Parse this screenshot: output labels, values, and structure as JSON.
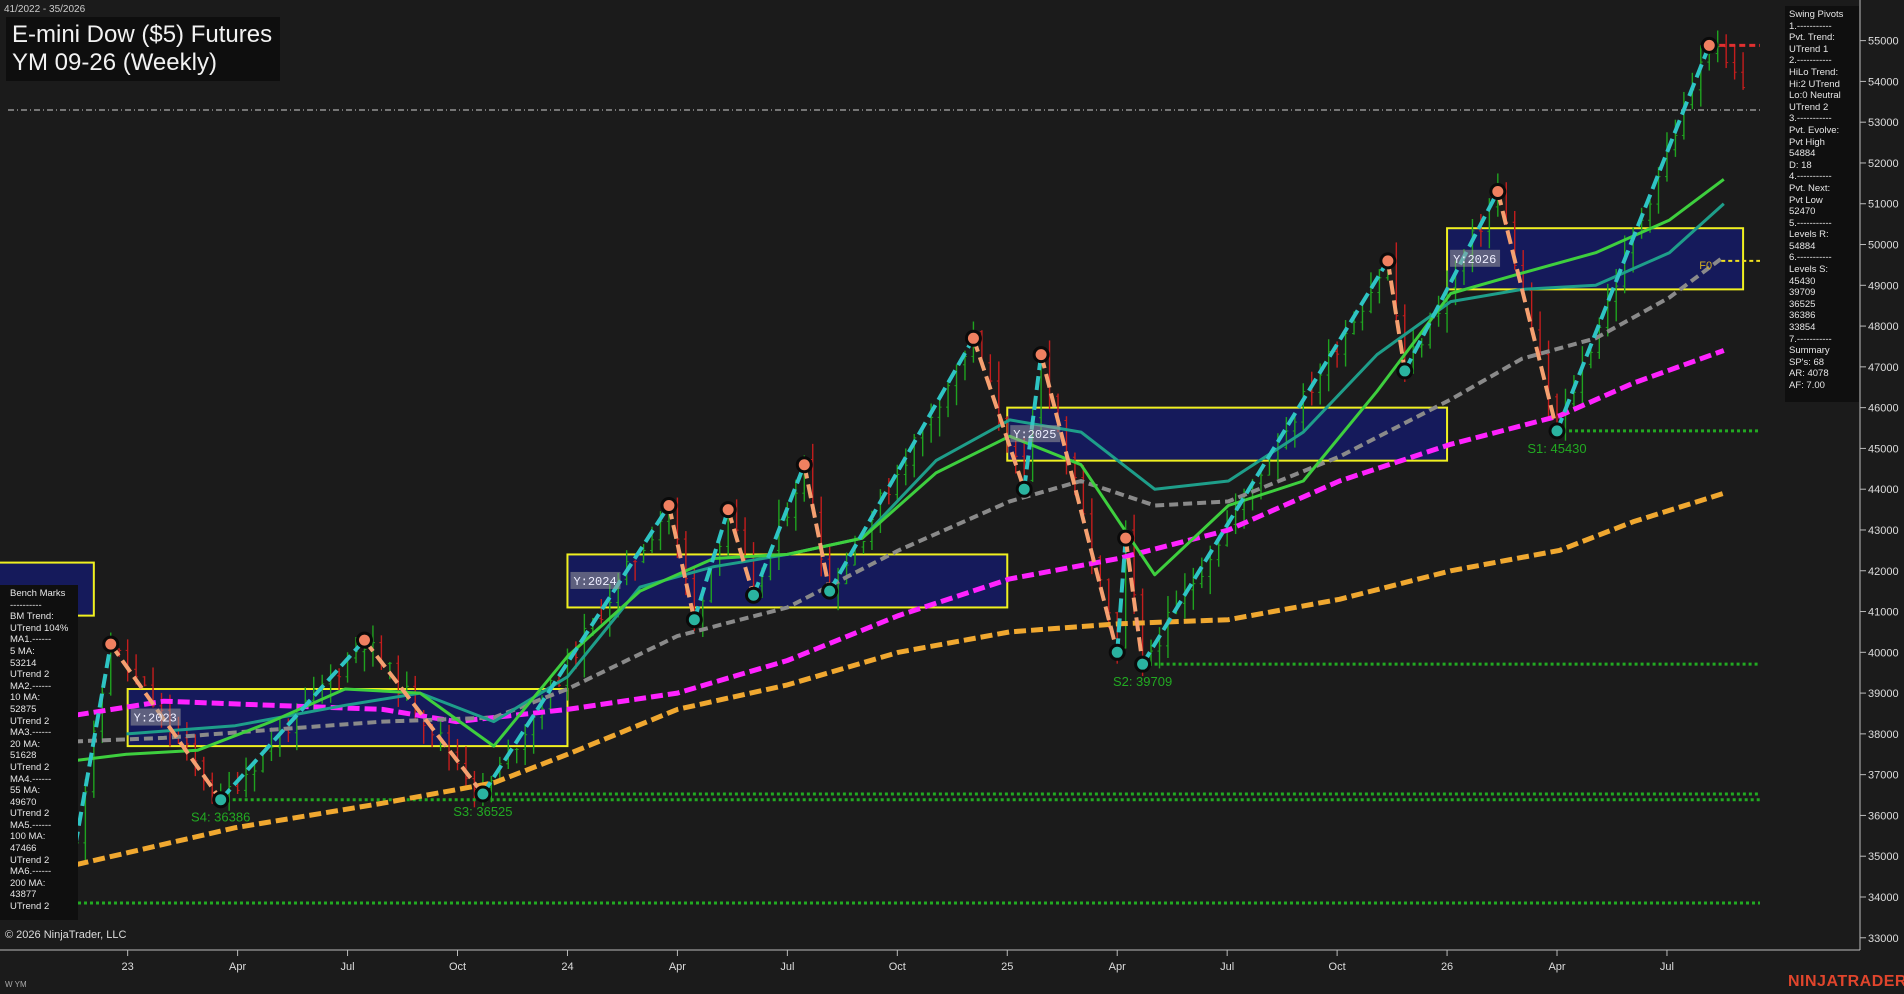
{
  "header": {
    "date_range": "41/2022 - 35/2026",
    "title_line1": "E-mini Dow ($5) Futures",
    "title_line2": "YM 09-26 (Weekly)"
  },
  "swing_panel": [
    "Swing Pivots",
    "1.-----------",
    "Pvt. Trend:",
    "UTrend 1",
    "2.-----------",
    "HiLo Trend:",
    "Hi:2 UTrend",
    "Lo:0 Neutral",
    "UTrend 2",
    "3.-----------",
    "Pvt. Evolve:",
    "Pvt High",
    "54884",
    "D: 18",
    "4.-----------",
    "Pvt. Next:",
    "Pvt Low",
    "52470",
    "5.-----------",
    "Levels R:",
    "54884",
    "6.-----------",
    "Levels S:",
    "45430",
    "39709",
    "36525",
    "36386",
    "33854",
    "7.-----------",
    "Summary",
    "SP's: 68",
    "AR: 4078",
    "AF: 7.00"
  ],
  "bench_panel": [
    "Bench Marks",
    "----------",
    "BM Trend:",
    "UTrend 104%",
    "MA1.------",
    "5 MA:",
    "53214",
    "UTrend 2",
    "MA2.------",
    "10 MA:",
    "52875",
    "UTrend 2",
    "MA3.------",
    "20 MA:",
    "51628",
    "UTrend 2",
    "MA4.------",
    "55 MA:",
    "49670",
    "UTrend 2",
    "MA5.------",
    "100 MA:",
    "47466",
    "UTrend 2",
    "MA6.------",
    "200 MA:",
    "43877",
    "UTrend 2"
  ],
  "footer": {
    "copyright": "© 2026 NinjaTrader, LLC",
    "symbol": "W YM",
    "brand": "NINJATRADER"
  },
  "colors": {
    "background": "#1b1b1b",
    "up_bar": "#1fa31f",
    "down_bar": "#c41d1d",
    "pivot_high": "#f08060",
    "pivot_low": "#2ab3a0",
    "swing_up": "#2ec4c4",
    "swing_down": "#f5a070",
    "ma_green": "#3ecf3e",
    "ma_teal": "#1e9e8a",
    "ma_gray": "#8a8a8a",
    "ma_magenta": "#ff22ff",
    "ma_orange": "#f0a830",
    "box_fill": "#141a66",
    "box_border": "#f0f020",
    "support": "#22aa22"
  },
  "chart_data": {
    "type": "candlestick",
    "timeframe": "Weekly",
    "y_range": [
      32700,
      55800
    ],
    "y_ticks": [
      33000,
      34000,
      35000,
      36000,
      37000,
      38000,
      39000,
      40000,
      41000,
      42000,
      43000,
      44000,
      45000,
      46000,
      47000,
      48000,
      49000,
      50000,
      51000,
      52000,
      53000,
      54000,
      55000
    ],
    "x_range": [
      "2022-11-07",
      "2026-09-14"
    ],
    "x_ticks": [
      {
        "date": "2023-01-02",
        "label": "23"
      },
      {
        "date": "2023-04-03",
        "label": "Apr"
      },
      {
        "date": "2023-07-03",
        "label": "Jul"
      },
      {
        "date": "2023-10-02",
        "label": "Oct"
      },
      {
        "date": "2024-01-01",
        "label": "24"
      },
      {
        "date": "2024-04-01",
        "label": "Apr"
      },
      {
        "date": "2024-07-01",
        "label": "Jul"
      },
      {
        "date": "2024-09-30",
        "label": "Oct"
      },
      {
        "date": "2024-12-30",
        "label": "25"
      },
      {
        "date": "2025-03-31",
        "label": "Apr"
      },
      {
        "date": "2025-06-30",
        "label": "Jul"
      },
      {
        "date": "2025-09-29",
        "label": "Oct"
      },
      {
        "date": "2025-12-29",
        "label": "26"
      },
      {
        "date": "2026-03-30",
        "label": "Apr"
      },
      {
        "date": "2026-06-29",
        "label": "Jul"
      }
    ],
    "current_price": 53300,
    "swing_points": [
      {
        "date": "2022-11-14",
        "price": 34300,
        "type": "low"
      },
      {
        "date": "2022-12-19",
        "price": 40200,
        "type": "high"
      },
      {
        "date": "2023-03-20",
        "price": 36386,
        "type": "low"
      },
      {
        "date": "2023-07-17",
        "price": 40300,
        "type": "high"
      },
      {
        "date": "2023-10-23",
        "price": 36525,
        "type": "low"
      },
      {
        "date": "2024-03-25",
        "price": 43600,
        "type": "high"
      },
      {
        "date": "2024-04-15",
        "price": 40800,
        "type": "low"
      },
      {
        "date": "2024-05-13",
        "price": 43500,
        "type": "high"
      },
      {
        "date": "2024-06-03",
        "price": 41400,
        "type": "low"
      },
      {
        "date": "2024-07-15",
        "price": 44600,
        "type": "high"
      },
      {
        "date": "2024-08-05",
        "price": 41500,
        "type": "low"
      },
      {
        "date": "2024-12-02",
        "price": 47700,
        "type": "high"
      },
      {
        "date": "2025-01-13",
        "price": 44000,
        "type": "low"
      },
      {
        "date": "2025-01-27",
        "price": 47300,
        "type": "high"
      },
      {
        "date": "2025-03-31",
        "price": 40000,
        "type": "low"
      },
      {
        "date": "2025-04-07",
        "price": 42800,
        "type": "high"
      },
      {
        "date": "2025-04-21",
        "price": 39709,
        "type": "low"
      },
      {
        "date": "2025-11-10",
        "price": 49600,
        "type": "high"
      },
      {
        "date": "2025-11-24",
        "price": 46900,
        "type": "low"
      },
      {
        "date": "2026-02-09",
        "price": 51300,
        "type": "high"
      },
      {
        "date": "2026-03-30",
        "price": 45430,
        "type": "low"
      },
      {
        "date": "2026-08-03",
        "price": 54884,
        "type": "high"
      }
    ],
    "support_levels": [
      {
        "price": 45430,
        "label": "S1: 45430",
        "from": "2026-03-30"
      },
      {
        "price": 39709,
        "label": "S2: 39709",
        "from": "2025-04-21"
      },
      {
        "price": 36525,
        "label": "S3: 36525",
        "from": "2023-10-23"
      },
      {
        "price": 36386,
        "label": "S4: 36386",
        "from": "2023-03-20"
      },
      {
        "price": 33854,
        "label": "",
        "from": "2022-11-07"
      }
    ],
    "resistance_levels": [
      {
        "price": 54884,
        "from": "2026-08-03"
      }
    ],
    "year_boxes": [
      {
        "label": "Y:2023",
        "start": "2023-01-02",
        "end": "2024-01-01",
        "high": 39100,
        "low": 37700
      },
      {
        "label": "Y:2024",
        "start": "2024-01-01",
        "end": "2024-12-30",
        "high": 42400,
        "low": 41100
      },
      {
        "label": "Y:2025",
        "start": "2024-12-30",
        "end": "2025-12-29",
        "high": 46000,
        "low": 44700
      },
      {
        "label": "Y:2026",
        "start": "2025-12-29",
        "end": "2026-08-31",
        "high": 50400,
        "low": 48900
      }
    ],
    "box_2022": {
      "label": "",
      "end": "2022-12-05",
      "high": 42200,
      "low": 40900
    },
    "f0_label": {
      "label": "F0",
      "date": "2026-08-03",
      "price": 49500
    },
    "moving_averages": [
      {
        "name": "200 MA",
        "color": "#f0a830",
        "style": "dash",
        "width": 5,
        "points": [
          [
            "2022-11-07",
            34700
          ],
          [
            "2023-04-01",
            35700
          ],
          [
            "2023-08-01",
            36300
          ],
          [
            "2023-11-01",
            36800
          ],
          [
            "2024-01-01",
            37500
          ],
          [
            "2024-04-01",
            38600
          ],
          [
            "2024-07-01",
            39200
          ],
          [
            "2024-10-01",
            40000
          ],
          [
            "2025-01-01",
            40500
          ],
          [
            "2025-04-01",
            40700
          ],
          [
            "2025-07-01",
            40800
          ],
          [
            "2025-10-01",
            41300
          ],
          [
            "2026-01-01",
            42000
          ],
          [
            "2026-04-01",
            42500
          ],
          [
            "2026-06-01",
            43200
          ],
          [
            "2026-08-15",
            43900
          ]
        ]
      },
      {
        "name": "100 MA",
        "color": "#ff22ff",
        "style": "dash",
        "width": 5,
        "points": [
          [
            "2022-11-07",
            38400
          ],
          [
            "2023-02-01",
            38800
          ],
          [
            "2023-05-01",
            38700
          ],
          [
            "2023-08-01",
            38600
          ],
          [
            "2023-10-01",
            38300
          ],
          [
            "2024-01-01",
            38600
          ],
          [
            "2024-04-01",
            39000
          ],
          [
            "2024-07-01",
            39800
          ],
          [
            "2024-10-01",
            40900
          ],
          [
            "2025-01-01",
            41800
          ],
          [
            "2025-04-01",
            42300
          ],
          [
            "2025-07-01",
            43000
          ],
          [
            "2025-10-01",
            44200
          ],
          [
            "2026-01-01",
            45100
          ],
          [
            "2026-04-01",
            45800
          ],
          [
            "2026-06-01",
            46600
          ],
          [
            "2026-08-15",
            47400
          ]
        ]
      },
      {
        "name": "55 MA",
        "color": "#8a8a8a",
        "style": "dash",
        "width": 4,
        "points": [
          [
            "2022-11-07",
            37800
          ],
          [
            "2023-02-01",
            37900
          ],
          [
            "2023-05-01",
            38100
          ],
          [
            "2023-08-01",
            38300
          ],
          [
            "2023-11-01",
            38400
          ],
          [
            "2024-01-01",
            39100
          ],
          [
            "2024-04-01",
            40400
          ],
          [
            "2024-07-01",
            41100
          ],
          [
            "2024-10-01",
            42500
          ],
          [
            "2025-01-01",
            43700
          ],
          [
            "2025-03-01",
            44200
          ],
          [
            "2025-05-01",
            43600
          ],
          [
            "2025-07-01",
            43700
          ],
          [
            "2025-10-01",
            44800
          ],
          [
            "2026-01-01",
            46200
          ],
          [
            "2026-03-01",
            47200
          ],
          [
            "2026-05-01",
            47700
          ],
          [
            "2026-07-01",
            48700
          ],
          [
            "2026-08-15",
            49700
          ]
        ]
      },
      {
        "name": "20 MA",
        "color": "#1e9e8a",
        "style": "solid",
        "width": 3,
        "points": [
          [
            "2023-01-01",
            38000
          ],
          [
            "2023-04-01",
            38200
          ],
          [
            "2023-07-01",
            38700
          ],
          [
            "2023-09-01",
            39000
          ],
          [
            "2023-11-01",
            38300
          ],
          [
            "2024-01-01",
            39400
          ],
          [
            "2024-03-01",
            41600
          ],
          [
            "2024-05-01",
            42100
          ],
          [
            "2024-07-01",
            42400
          ],
          [
            "2024-09-01",
            42800
          ],
          [
            "2024-11-01",
            44700
          ],
          [
            "2025-01-01",
            45700
          ],
          [
            "2025-03-01",
            45400
          ],
          [
            "2025-05-01",
            44000
          ],
          [
            "2025-07-01",
            44200
          ],
          [
            "2025-09-01",
            45400
          ],
          [
            "2025-11-01",
            47300
          ],
          [
            "2026-01-01",
            48600
          ],
          [
            "2026-03-01",
            48900
          ],
          [
            "2026-05-01",
            49000
          ],
          [
            "2026-07-01",
            49800
          ],
          [
            "2026-08-15",
            51000
          ]
        ]
      },
      {
        "name": "10 MA",
        "color": "#3ecf3e",
        "style": "solid",
        "width": 3,
        "points": [
          [
            "2022-11-07",
            37300
          ],
          [
            "2023-01-01",
            37500
          ],
          [
            "2023-03-01",
            37600
          ],
          [
            "2023-05-01",
            38300
          ],
          [
            "2023-07-01",
            39100
          ],
          [
            "2023-09-01",
            39000
          ],
          [
            "2023-11-01",
            37700
          ],
          [
            "2024-01-01",
            39900
          ],
          [
            "2024-03-01",
            41500
          ],
          [
            "2024-05-01",
            42300
          ],
          [
            "2024-07-01",
            42400
          ],
          [
            "2024-09-01",
            42800
          ],
          [
            "2024-11-01",
            44400
          ],
          [
            "2025-01-01",
            45300
          ],
          [
            "2025-03-01",
            44600
          ],
          [
            "2025-05-01",
            41900
          ],
          [
            "2025-07-01",
            43600
          ],
          [
            "2025-09-01",
            44200
          ],
          [
            "2025-11-01",
            46400
          ],
          [
            "2026-01-01",
            48800
          ],
          [
            "2026-03-01",
            49300
          ],
          [
            "2026-05-01",
            49800
          ],
          [
            "2026-07-01",
            50600
          ],
          [
            "2026-08-15",
            51600
          ]
        ]
      }
    ]
  }
}
